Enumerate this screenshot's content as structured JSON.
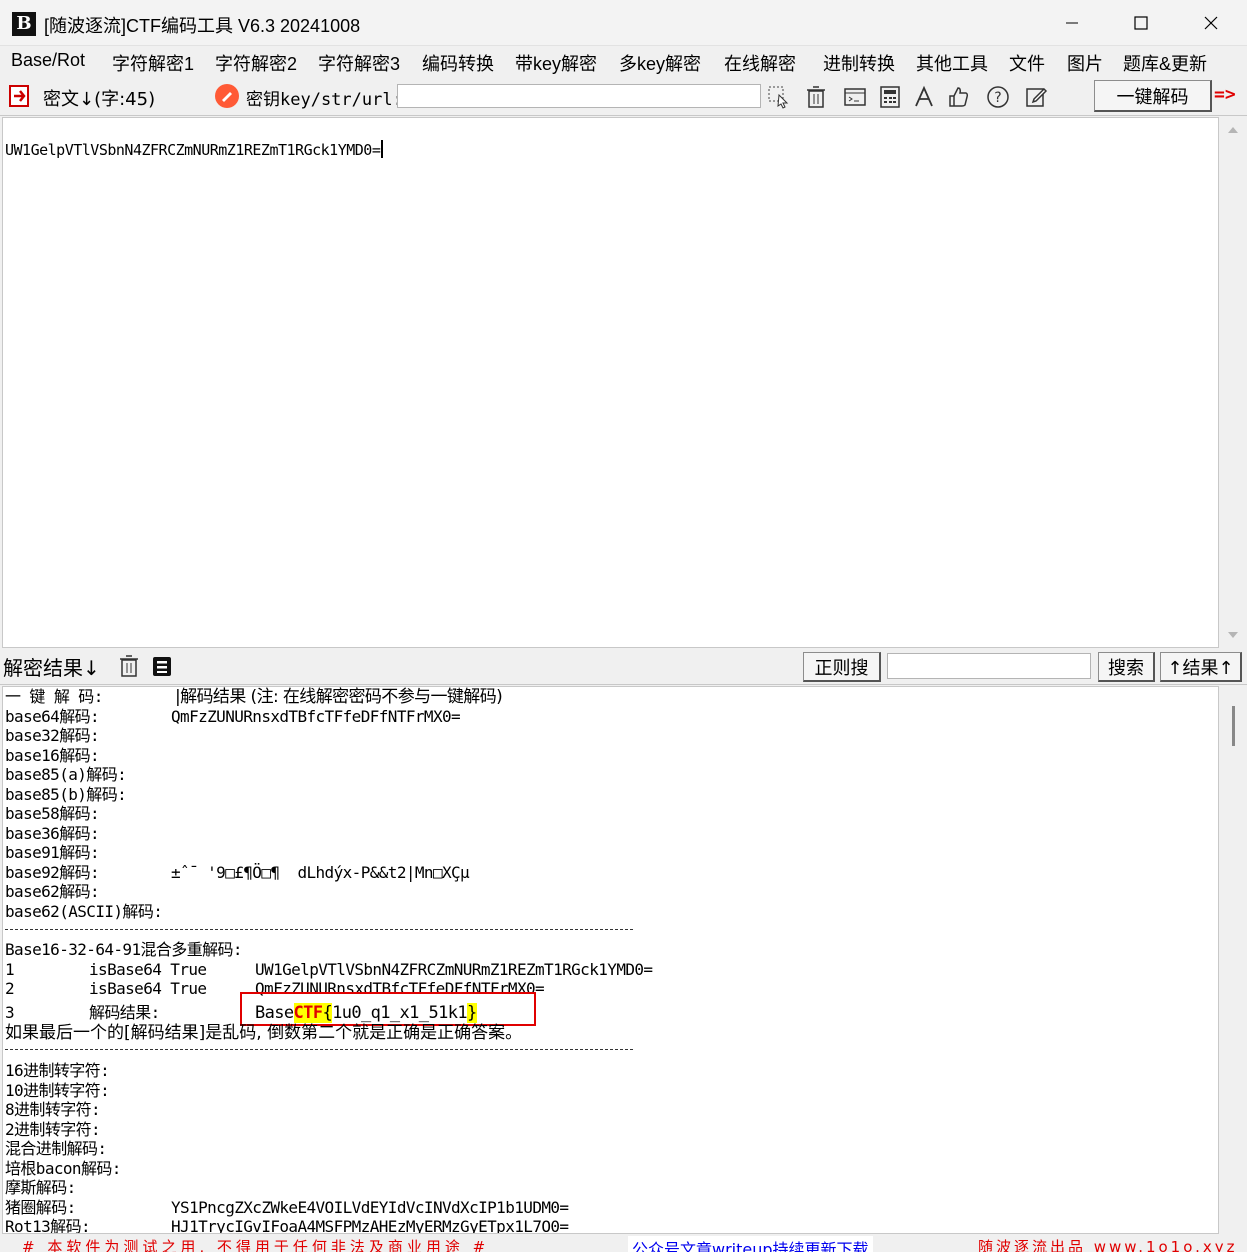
{
  "window": {
    "title": "[随波逐流]CTF编码工具 V6.3 20241008",
    "logo_text": "B"
  },
  "menu": [
    "Base/Rot",
    "字符解密1",
    "字符解密2",
    "字符解密3",
    "编码转换",
    "带key解密",
    "多key解密",
    "在线解密",
    "进制转换",
    "其他工具",
    "文件",
    "图片",
    "题库&更新"
  ],
  "toolbar": {
    "cipher_label": "密文↓(字:45)",
    "key_label": "密钥key/str/url:",
    "key_value": "",
    "decode_button": "一键解码",
    "go_arrow": "=>"
  },
  "cipher": {
    "text": "UW1GelpVTlVSbnN4ZFRCZmNURmZ1REZmT1RGck1YMD0="
  },
  "result_bar": {
    "label": "解密结果↓",
    "regex_button": "正则搜",
    "search_value": "",
    "search_button": "搜索",
    "result_nav_button": "↑结果↑"
  },
  "results": {
    "header_left": "一 键 解 码:",
    "header_right": "|解码结果 (注: 在线解密密码不参与一键解码)",
    "rows": [
      {
        "label": "base64解码:",
        "value": "QmFzZUNURnsxdTBfcTFfeDFfNTFrMX0="
      },
      {
        "label": "base32解码:",
        "value": ""
      },
      {
        "label": "base16解码:",
        "value": ""
      },
      {
        "label": "base85(a)解码:",
        "value": ""
      },
      {
        "label": "base85(b)解码:",
        "value": ""
      },
      {
        "label": "base58解码:",
        "value": ""
      },
      {
        "label": "base36解码:",
        "value": ""
      },
      {
        "label": "base91解码:",
        "value": ""
      },
      {
        "label": "base92解码:",
        "value": "±ˆ¯ '9□£¶Ö□¶  dLhdýx-P&&t2|Mn□XÇµ"
      },
      {
        "label": "base62解码:",
        "value": ""
      },
      {
        "label": "base62(ASCII)解码:",
        "value": ""
      }
    ],
    "mix_title": "Base16-32-64-91混合多重解码:",
    "mix_rows": [
      {
        "n": "1",
        "type": "isBase64 True",
        "value": "UW1GelpVTlVSbnN4ZFRCZmNURmZ1REZmT1RGck1YMD0="
      },
      {
        "n": "2",
        "type": "isBase64 True",
        "value": "QmFzZUNURnsxdTBfcTFfeDFfNTFrMX0="
      }
    ],
    "final_label": "解码结果:",
    "final_prefix": "Base",
    "final_ctf": "CTF",
    "final_open": "{",
    "final_body": "1u0_q1_x1_51k1",
    "final_close": "}",
    "note": "如果最后一个的[解码结果]是乱码, 倒数第二个就是正确是正确答案。",
    "other_rows": [
      {
        "label": "16进制转字符:",
        "value": ""
      },
      {
        "label": "10进制转字符:",
        "value": ""
      },
      {
        "label": "8进制转字符:",
        "value": ""
      },
      {
        "label": "2进制转字符:",
        "value": ""
      },
      {
        "label": "混合进制解码:",
        "value": ""
      },
      {
        "label": "培根bacon解码:",
        "value": ""
      },
      {
        "label": "摩斯解码:",
        "value": ""
      },
      {
        "label": "猪圈解码:",
        "value": "YS1PncgZXcZWkeE4VOILVdEYIdVcINVdXcIP1b1UDM0="
      },
      {
        "label": "Rot13解码:",
        "value": "HJ1TrycIGvIFoaA4MSFPMzAHEzMyERMzGyETpx1L7O0="
      }
    ]
  },
  "status": {
    "left": "# 本软件为测试之用, 不得用于任何非法及商业用途 #",
    "middle": "公众号文章writeup持续更新下载",
    "right": "随波逐流出品 www.1o1o.xyz"
  },
  "colors": {
    "accent_red": "#e00000",
    "highlight_yellow": "#ffff00",
    "link_blue": "#0000ee"
  }
}
